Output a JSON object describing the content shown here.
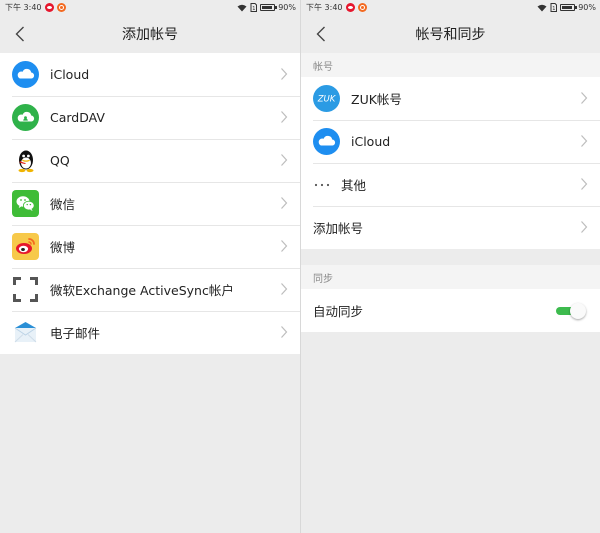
{
  "status_bar": {
    "time": "下午 3:40",
    "battery": "90%",
    "battery_level": 0.9
  },
  "left": {
    "title": "添加帐号",
    "items": [
      {
        "label": "iCloud",
        "icon": "icloud-icon"
      },
      {
        "label": "CardDAV",
        "icon": "carddav-icon"
      },
      {
        "label": "QQ",
        "icon": "qq-icon"
      },
      {
        "label": "微信",
        "icon": "wechat-icon"
      },
      {
        "label": "微博",
        "icon": "weibo-icon"
      },
      {
        "label": "微软Exchange ActiveSync帐户",
        "icon": "exchange-icon"
      },
      {
        "label": "电子邮件",
        "icon": "email-icon"
      }
    ]
  },
  "right": {
    "title": "帐号和同步",
    "accounts_header": "帐号",
    "accounts": [
      {
        "label": "ZUK帐号",
        "icon": "zuk-icon",
        "icon_text": "ZUK"
      },
      {
        "label": "iCloud",
        "icon": "icloud-icon"
      },
      {
        "label": "其他",
        "icon": "more-dots-icon"
      },
      {
        "label": "添加帐号"
      }
    ],
    "sync_header": "同步",
    "auto_sync": {
      "label": "自动同步",
      "enabled": true
    }
  },
  "colors": {
    "accent_green": "#3dbb4e",
    "icloud_blue": "#1e8ef0",
    "carddav_green": "#2fb24a",
    "wechat_green": "#3fbc37",
    "weibo_red": "#e6162d",
    "zuk_blue": "#2b9be4"
  }
}
